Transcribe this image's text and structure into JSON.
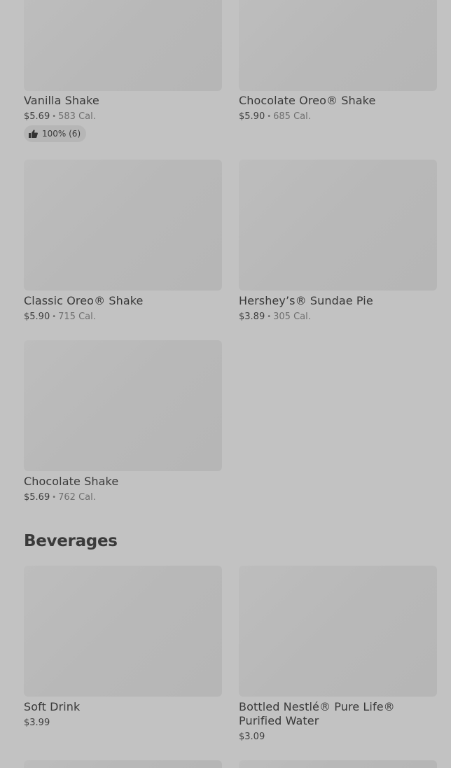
{
  "desserts": [
    {
      "name": "Vanilla Shake",
      "price": "$5.69",
      "calories": "583 Cal.",
      "rating": "100% (6)"
    },
    {
      "name": "Chocolate Oreo® Shake",
      "price": "$5.90",
      "calories": "685 Cal."
    },
    {
      "name": "Classic Oreo® Shake",
      "price": "$5.90",
      "calories": "715 Cal."
    },
    {
      "name": "Hershey’s® Sundae Pie",
      "price": "$3.89",
      "calories": "305 Cal."
    },
    {
      "name": "Chocolate Shake",
      "price": "$5.69",
      "calories": "762 Cal."
    }
  ],
  "beverages_section": {
    "title": "Beverages",
    "items": [
      {
        "name": "Soft Drink",
        "price": "$3.99"
      },
      {
        "name": "Bottled Nestlé® Pure Life® Purified Water",
        "price": "$3.09"
      }
    ]
  },
  "separator": "•",
  "icons": {
    "rating": "thumbs-up-icon"
  }
}
